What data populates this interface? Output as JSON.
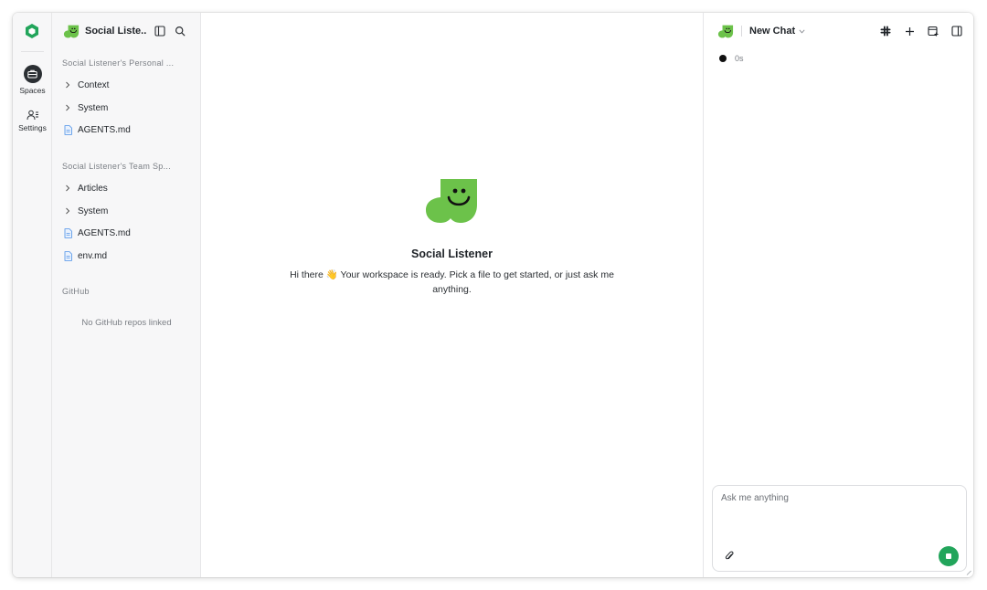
{
  "app": {
    "brand_color": "#22a55b",
    "accent_green": "#6cc24a"
  },
  "rail": {
    "items": [
      {
        "label": "Spaces",
        "icon": "briefcase-icon",
        "active": true
      },
      {
        "label": "Settings",
        "icon": "users-settings-icon",
        "active": false
      }
    ]
  },
  "sidebar": {
    "title": "Social Liste...",
    "personal": {
      "heading": "Social Listener's Personal ...",
      "items": [
        {
          "label": "Context",
          "type": "folder"
        },
        {
          "label": "System",
          "type": "folder"
        },
        {
          "label": "AGENTS.md",
          "type": "file"
        }
      ]
    },
    "team": {
      "heading": "Social Listener's Team Sp...",
      "items": [
        {
          "label": "Articles",
          "type": "folder"
        },
        {
          "label": "System",
          "type": "folder"
        },
        {
          "label": "AGENTS.md",
          "type": "file"
        },
        {
          "label": "env.md",
          "type": "file"
        }
      ]
    },
    "github": {
      "heading": "GitHub",
      "empty": "No GitHub repos linked"
    }
  },
  "main": {
    "title": "Social Listener",
    "subtitle": "Hi there 👋 Your workspace is ready. Pick a file to get started, or just ask me anything."
  },
  "chat": {
    "title": "New Chat",
    "status": "0s",
    "composer": {
      "placeholder": "Ask me anything",
      "value": ""
    }
  }
}
